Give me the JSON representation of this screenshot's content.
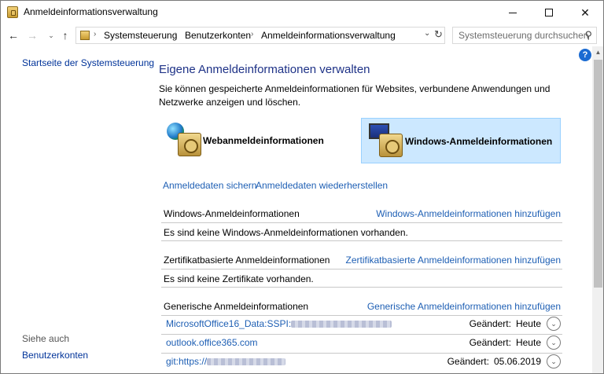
{
  "window": {
    "title": "Anmeldeinformationsverwaltung",
    "minimize": "",
    "maximize": "",
    "close": "✕"
  },
  "nav": {
    "back": "←",
    "forward": "→",
    "recent": "⌄",
    "up": "↑",
    "breadcrumb": [
      "Systemsteuerung",
      "Benutzerkonten",
      "Anmeldeinformationsverwaltung"
    ],
    "separator": "›",
    "dropdown": "⌄",
    "refresh": "↻",
    "search_placeholder": "Systemsteuerung durchsuchen",
    "search_glyph": "⚲"
  },
  "left": {
    "home_link": "Startseite der Systemsteuerung",
    "see_also": "Siehe auch",
    "user_accounts": "Benutzerkonten"
  },
  "main": {
    "help": "?",
    "title": "Eigene Anmeldeinformationen verwalten",
    "description": "Sie können gespeicherte Anmeldeinformationen für Websites, verbundene Anwendungen und Netzwerke anzeigen und löschen.",
    "tiles": {
      "web": "Webanmeldeinformationen",
      "windows": "Windows-Anmeldeinformationen"
    },
    "backup_link": "Anmeldedaten sichern",
    "restore_link": "Anmeldedaten wiederherstellen",
    "sections": {
      "windows": {
        "title": "Windows-Anmeldeinformationen",
        "add": "Windows-Anmeldeinformationen hinzufügen",
        "empty": "Es sind keine Windows-Anmeldeinformationen vorhanden."
      },
      "cert": {
        "title": "Zertifikatbasierte Anmeldeinformationen",
        "add": "Zertifikatbasierte Anmeldeinformationen hinzufügen",
        "empty": "Es sind keine Zertifikate vorhanden."
      },
      "generic": {
        "title": "Generische Anmeldeinformationen",
        "add": "Generische Anmeldeinformationen hinzufügen",
        "items": [
          {
            "name": "MicrosoftOffice16_Data:SSPI:",
            "changed_label": "Geändert:",
            "changed": "Heute"
          },
          {
            "name": "outlook.office365.com",
            "changed_label": "Geändert:",
            "changed": "Heute"
          },
          {
            "name": "git:https://",
            "changed_label": "Geändert:",
            "changed": "05.06.2019"
          }
        ],
        "expand_glyph": "⌄"
      }
    }
  },
  "scroll": {
    "up": "▲"
  },
  "colors": {
    "link": "#1e5fb4",
    "title": "#1e3287",
    "tile_selected": "#cce8ff"
  }
}
